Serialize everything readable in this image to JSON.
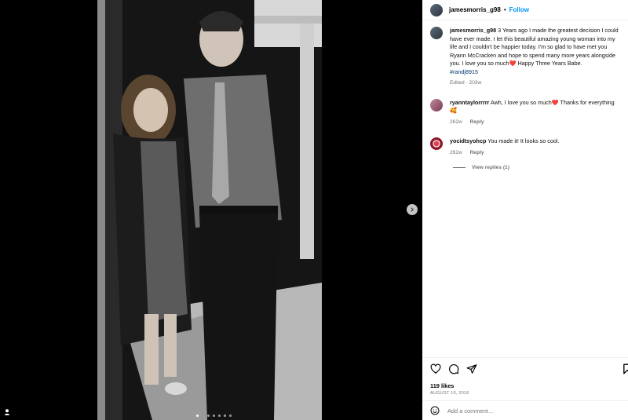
{
  "post": {
    "author": "jamesmorris_g98",
    "follow_label": "Follow",
    "separator": "•"
  },
  "caption": {
    "user": "jamesmorris_g98",
    "text": "3 Years ago I made the greatest decision I could have ever made. I let this beautiful amazing young woman into my life and I couldn't be happier today. I'm so glad to have met you Ryann McCracken and hope to spend many more years alongside you. I love you so much",
    "heart": "❤️",
    "text_after": " Happy Three Years Babe.",
    "hashtag": "#randj8915",
    "meta": "Edited · 203w"
  },
  "comments": [
    {
      "user": "ryanntaylorrrrr",
      "text": "Awh, I love you so much",
      "heart": "❤️",
      "text_after": " Thanks for everything",
      "emoji": "🥰",
      "age": "262w",
      "reply_label": "Reply"
    },
    {
      "user": "yocidtsyohcp",
      "text": "You made it! It looks so cool.",
      "age": "262w",
      "reply_label": "Reply",
      "view_replies": "View replies (1)"
    }
  ],
  "likes": "119 likes",
  "date": "AUGUST 10, 2016",
  "add_comment_placeholder": "Add a comment…",
  "carousel": {
    "total": 7,
    "active": 0
  },
  "colors": {
    "link": "#0095f6",
    "heart": "#ed4956",
    "muted": "#737373"
  },
  "icons": [
    "heart-icon",
    "comment-icon",
    "share-icon",
    "bookmark-icon",
    "emoji-icon",
    "chevron-right-icon",
    "user-tag-icon"
  ]
}
